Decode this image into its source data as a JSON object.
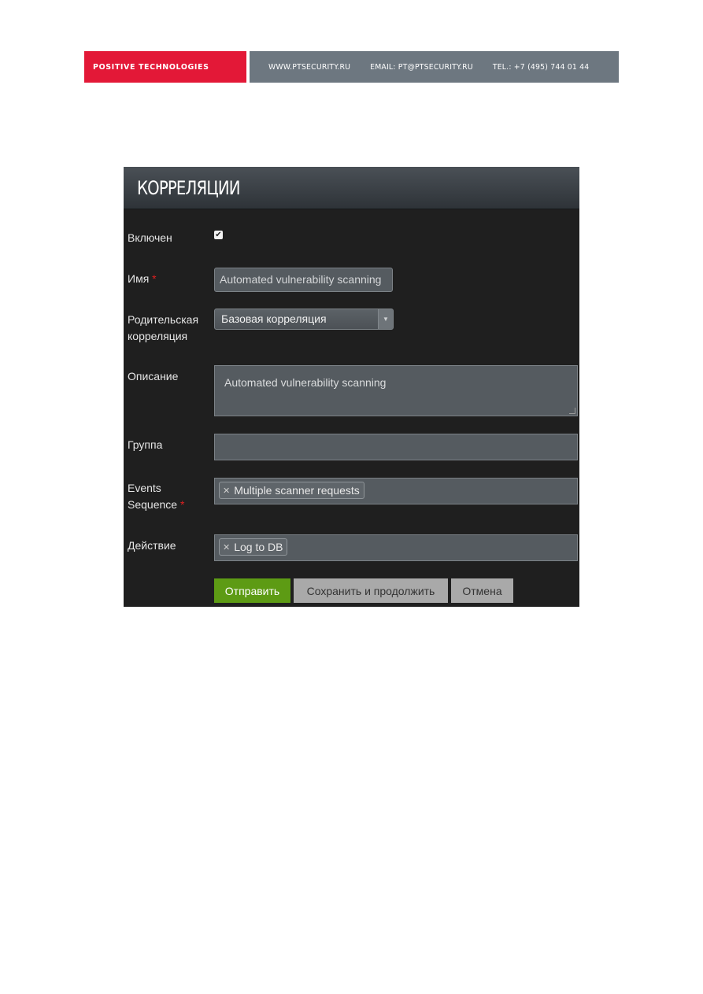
{
  "banner": {
    "brand": "POSITIVE TECHNOLOGIES",
    "website": "WWW.PTSECURITY.RU",
    "email": "EMAIL: PT@PTSECURITY.RU",
    "phone": "TEL.: +7 (495) 744 01 44",
    "brand_color": "#e31837"
  },
  "panel": {
    "title": "КОРРЕЛЯЦИИ"
  },
  "form": {
    "enabled": {
      "label": "Включен",
      "checked": true
    },
    "name": {
      "label": "Имя",
      "required_mark": "*",
      "value": "Automated vulnerability scanning"
    },
    "parent": {
      "label_line1": "Родительская",
      "label_line2": "корреляция",
      "value": "Базовая корреляция"
    },
    "description": {
      "label": "Описание",
      "value": "Automated vulnerability scanning"
    },
    "group": {
      "label": "Группа",
      "value": ""
    },
    "events_sequence": {
      "label_line1": "Events",
      "label_line2": "Sequence",
      "required_mark": "*",
      "tags": [
        "Multiple scanner requests"
      ]
    },
    "action": {
      "label": "Действие",
      "tags": [
        "Log to DB"
      ]
    }
  },
  "buttons": {
    "submit": "Отправить",
    "save_continue": "Сохранить и продолжить",
    "cancel": "Отмена",
    "submit_color": "#5d9b14"
  }
}
